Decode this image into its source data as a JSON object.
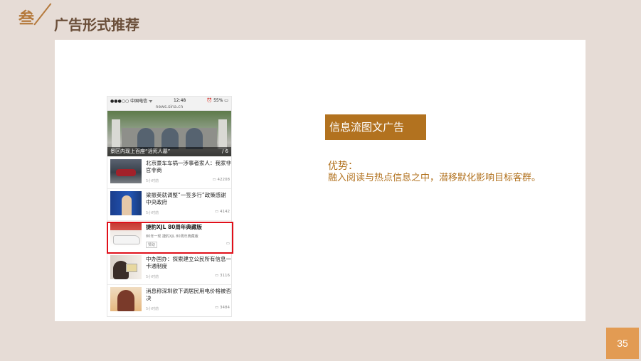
{
  "header": {
    "marker_char": "叁",
    "title": "广告形式推荐"
  },
  "phone": {
    "status_carrier": "●●●○○ 中国电信 ᯤ",
    "status_time": "12:48",
    "status_battery": "⏰ 55% ▭",
    "url": "news.sina.cn",
    "hero_caption": "景区内现上百座“活死人墓”",
    "hero_counter": "/ 6",
    "news": [
      {
        "title": "北京豪车车祸一涉事者家人：我家非官非商",
        "time": "5小时前",
        "comments": "▭ 42208"
      },
      {
        "title": "梁振英就调整“一签多行”政策感谢中央政府",
        "time": "5小时前",
        "comments": "▭ 4142"
      },
      {
        "title": "捷豹XJL 80周年典藏版",
        "subtitle": "80年一现 捷豹XJL 80周年典藏版",
        "tag": "赞助",
        "comments": "▭"
      },
      {
        "title": "中办国办：探索建立公民所有信息一卡通制度",
        "time": "5小时前",
        "comments": "▭ 3116"
      },
      {
        "title": "消息称深圳欲下调居民用电价格被否决",
        "time": "5小时前",
        "comments": "▭ 3484"
      }
    ]
  },
  "ad_type_label": "信息流图文广告",
  "advantage": {
    "title": "优势：",
    "body": "融入阅读与热点信息之中，潜移默化影响目标客群。"
  },
  "page_number": "35",
  "colors": {
    "background": "#e6dcd6",
    "accent": "#b2721f",
    "page_badge": "#e29b53",
    "highlight": "#e0101a"
  }
}
